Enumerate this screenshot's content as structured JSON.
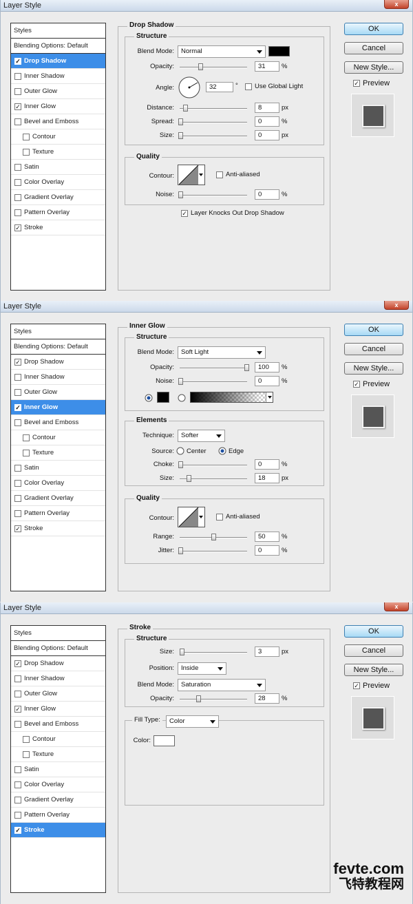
{
  "window_title": "Layer Style",
  "close_glyph": "x",
  "buttons": {
    "ok": "OK",
    "cancel": "Cancel",
    "new_style": "New Style...",
    "preview": "Preview"
  },
  "style_list": [
    "Styles",
    "Blending Options: Default",
    "Drop Shadow",
    "Inner Shadow",
    "Outer Glow",
    "Inner Glow",
    "Bevel and Emboss",
    "Contour",
    "Texture",
    "Satin",
    "Color Overlay",
    "Gradient Overlay",
    "Pattern Overlay",
    "Stroke"
  ],
  "checkmark": "✓",
  "panel1": {
    "title": "Drop Shadow",
    "structure": "Structure",
    "blend_mode_label": "Blend Mode:",
    "blend_mode": "Normal",
    "shadow_color": "#000000",
    "opacity_label": "Opacity:",
    "opacity": "31",
    "angle_label": "Angle:",
    "angle": "32",
    "degree": "°",
    "use_global_light": "Use Global Light",
    "distance_label": "Distance:",
    "distance": "8",
    "spread_label": "Spread:",
    "spread": "0",
    "size_label": "Size:",
    "size": "0",
    "quality": "Quality",
    "contour_label": "Contour:",
    "anti_aliased": "Anti-aliased",
    "noise_label": "Noise:",
    "noise": "0",
    "knocks_out": "Layer Knocks Out Drop Shadow"
  },
  "panel2": {
    "title": "Inner Glow",
    "structure": "Structure",
    "blend_mode_label": "Blend Mode:",
    "blend_mode": "Soft Light",
    "opacity_label": "Opacity:",
    "opacity": "100",
    "noise_label": "Noise:",
    "noise": "0",
    "glow_color": "#000000",
    "elements": "Elements",
    "technique_label": "Technique:",
    "technique": "Softer",
    "source_label": "Source:",
    "center": "Center",
    "edge": "Edge",
    "choke_label": "Choke:",
    "choke": "0",
    "size_label": "Size:",
    "size": "18",
    "quality": "Quality",
    "contour_label": "Contour:",
    "anti_aliased": "Anti-aliased",
    "range_label": "Range:",
    "range": "50",
    "jitter_label": "Jitter:",
    "jitter": "0"
  },
  "panel3": {
    "title": "Stroke",
    "structure": "Structure",
    "size_label": "Size:",
    "size": "3",
    "position_label": "Position:",
    "position": "Inside",
    "blend_mode_label": "Blend Mode:",
    "blend_mode": "Saturation",
    "opacity_label": "Opacity:",
    "opacity": "28",
    "fill_type_label": "Fill Type:",
    "fill_type": "Color",
    "color_label": "Color:",
    "stroke_color": "#ffffff"
  },
  "units": {
    "percent": "%",
    "px": "px"
  },
  "watermark": {
    "line1": "fevte.com",
    "line2": "飞特教程网"
  },
  "colors": {
    "selection": "#3d8ee8"
  }
}
